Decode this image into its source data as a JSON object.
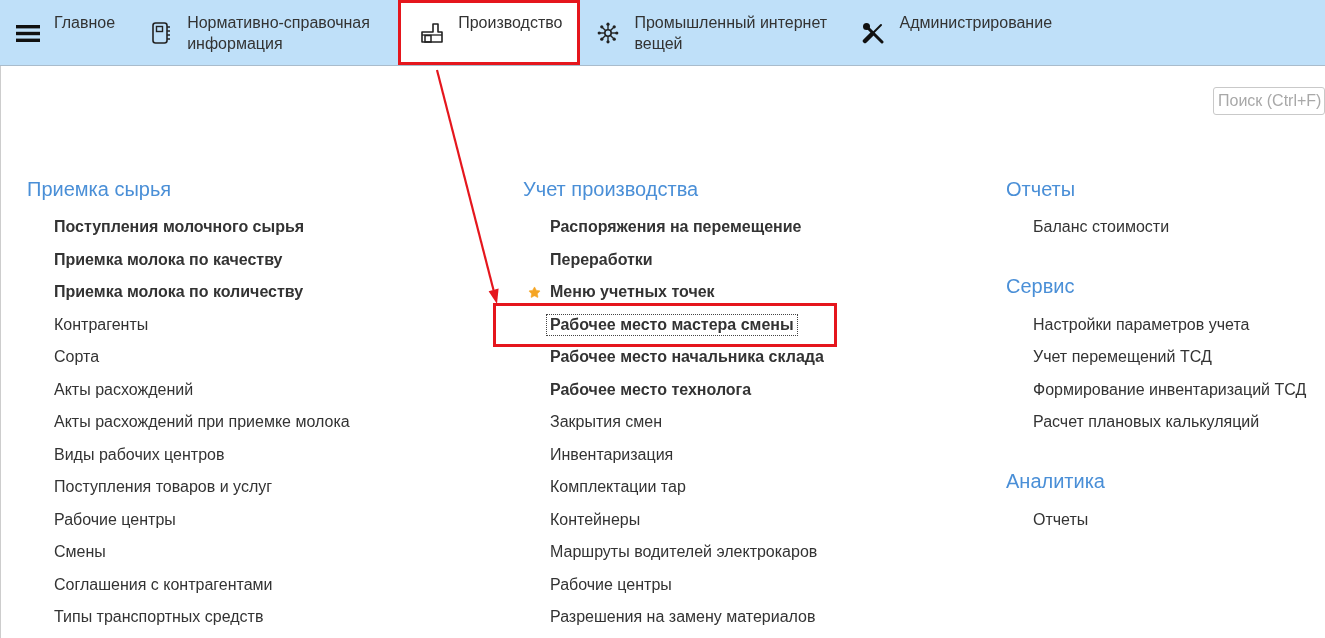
{
  "navbar": {
    "tabs": [
      {
        "label": "Главное",
        "selected": false,
        "highlighted": false
      },
      {
        "label": "Нормативно-справочная информация",
        "selected": false,
        "highlighted": false
      },
      {
        "label": "Производство",
        "selected": true,
        "highlighted": true
      },
      {
        "label": "Промышленный интернет вещей",
        "selected": false,
        "highlighted": false
      },
      {
        "label": "Администрирование",
        "selected": false,
        "highlighted": false
      }
    ]
  },
  "search": {
    "placeholder": "Поиск (Ctrl+F)"
  },
  "columns": [
    {
      "sections": [
        {
          "title": "Приемка сырья",
          "items": [
            {
              "label": "Поступления молочного сырья",
              "bold": true,
              "favorite": false,
              "focused": false,
              "highlighted": false
            },
            {
              "label": "Приемка молока по качеству",
              "bold": true,
              "favorite": false,
              "focused": false,
              "highlighted": false
            },
            {
              "label": "Приемка молока по количеству",
              "bold": true,
              "favorite": false,
              "focused": false,
              "highlighted": false
            },
            {
              "label": "Контрагенты",
              "bold": false,
              "favorite": false,
              "focused": false,
              "highlighted": false
            },
            {
              "label": "Сорта",
              "bold": false,
              "favorite": false,
              "focused": false,
              "highlighted": false
            },
            {
              "label": "Акты расхождений",
              "bold": false,
              "favorite": false,
              "focused": false,
              "highlighted": false
            },
            {
              "label": "Акты расхождений при приемке молока",
              "bold": false,
              "favorite": false,
              "focused": false,
              "highlighted": false
            },
            {
              "label": "Виды рабочих центров",
              "bold": false,
              "favorite": false,
              "focused": false,
              "highlighted": false
            },
            {
              "label": "Поступления товаров и услуг",
              "bold": false,
              "favorite": false,
              "focused": false,
              "highlighted": false
            },
            {
              "label": "Рабочие центры",
              "bold": false,
              "favorite": false,
              "focused": false,
              "highlighted": false
            },
            {
              "label": "Смены",
              "bold": false,
              "favorite": false,
              "focused": false,
              "highlighted": false
            },
            {
              "label": "Соглашения с контрагентами",
              "bold": false,
              "favorite": false,
              "focused": false,
              "highlighted": false
            },
            {
              "label": "Типы транспортных средств",
              "bold": false,
              "favorite": false,
              "focused": false,
              "highlighted": false
            }
          ]
        }
      ]
    },
    {
      "sections": [
        {
          "title": "Учет производства",
          "items": [
            {
              "label": "Распоряжения на перемещение",
              "bold": true,
              "favorite": false,
              "focused": false,
              "highlighted": false
            },
            {
              "label": "Переработки",
              "bold": true,
              "favorite": false,
              "focused": false,
              "highlighted": false
            },
            {
              "label": "Меню учетных точек",
              "bold": true,
              "favorite": true,
              "focused": false,
              "highlighted": false
            },
            {
              "label": "Рабочее место мастера смены",
              "bold": true,
              "favorite": false,
              "focused": true,
              "highlighted": true
            },
            {
              "label": "Рабочее место начальника склада",
              "bold": true,
              "favorite": false,
              "focused": false,
              "highlighted": false
            },
            {
              "label": "Рабочее место технолога",
              "bold": true,
              "favorite": false,
              "focused": false,
              "highlighted": false
            },
            {
              "label": "Закрытия смен",
              "bold": false,
              "favorite": false,
              "focused": false,
              "highlighted": false
            },
            {
              "label": "Инвентаризация",
              "bold": false,
              "favorite": false,
              "focused": false,
              "highlighted": false
            },
            {
              "label": "Комплектации тар",
              "bold": false,
              "favorite": false,
              "focused": false,
              "highlighted": false
            },
            {
              "label": "Контейнеры",
              "bold": false,
              "favorite": false,
              "focused": false,
              "highlighted": false
            },
            {
              "label": "Маршруты водителей электрокаров",
              "bold": false,
              "favorite": false,
              "focused": false,
              "highlighted": false
            },
            {
              "label": "Рабочие центры",
              "bold": false,
              "favorite": false,
              "focused": false,
              "highlighted": false
            },
            {
              "label": "Разрешения на замену материалов",
              "bold": false,
              "favorite": false,
              "focused": false,
              "highlighted": false
            }
          ]
        }
      ]
    },
    {
      "sections": [
        {
          "title": "Отчеты",
          "items": [
            {
              "label": "Баланс стоимости",
              "bold": false,
              "favorite": false,
              "focused": false,
              "highlighted": false
            }
          ]
        },
        {
          "title": "Сервис",
          "items": [
            {
              "label": "Настройки параметров учета",
              "bold": false,
              "favorite": false,
              "focused": false,
              "highlighted": false
            },
            {
              "label": "Учет перемещений ТСД",
              "bold": false,
              "favorite": false,
              "focused": false,
              "highlighted": false
            },
            {
              "label": "Формирование инвентаризаций ТСД",
              "bold": false,
              "favorite": false,
              "focused": false,
              "highlighted": false
            },
            {
              "label": "Расчет плановых калькуляций",
              "bold": false,
              "favorite": false,
              "focused": false,
              "highlighted": false
            }
          ]
        },
        {
          "title": "Аналитика",
          "items": [
            {
              "label": "Отчеты",
              "bold": false,
              "favorite": false,
              "focused": false,
              "highlighted": false
            }
          ]
        }
      ]
    }
  ],
  "annotation": {
    "arrow": true
  }
}
